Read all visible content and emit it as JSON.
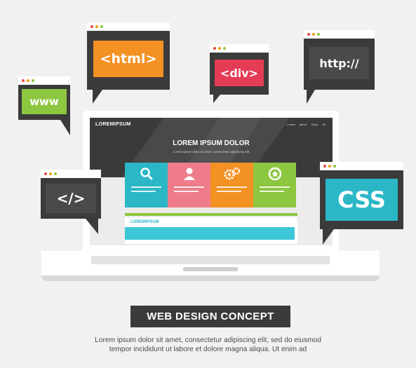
{
  "colors": {
    "background": "#f1f1f1",
    "dark": "#3b3b3b",
    "orange": "#f39123",
    "red": "#e53c55",
    "green": "#8dc63f",
    "cyan": "#2bb7c6",
    "pink": "#ee7c8a",
    "dot_red": "#e74c3c",
    "dot_yellow": "#f39c12",
    "dot_green": "#8dc63f"
  },
  "bubbles": {
    "html": {
      "label": "<html>",
      "panel_color": "#f39123"
    },
    "div": {
      "label": "<div>",
      "panel_color": "#e53c55"
    },
    "http": {
      "label": "http://",
      "panel_color": "#3b3b3b"
    },
    "www": {
      "label": "www",
      "panel_color": "#8dc63f"
    },
    "code": {
      "label": "</>",
      "panel_color": "#3b3b3b"
    },
    "css": {
      "label": "CSS",
      "panel_color": "#2bb7c6"
    }
  },
  "website": {
    "brand": "LOREMIPSUM",
    "nav": [
      "Lorem",
      "Ipsum",
      "Dolor",
      "Sit"
    ],
    "hero_title": "LOREM IPSUM DOLOR",
    "hero_subtitle": "Lorem ipsum dolor sit amet, consectetur adipiscing elit",
    "cards": [
      {
        "icon": "search-icon",
        "color": "#2bb7c6"
      },
      {
        "icon": "user-icon",
        "color": "#ee7c8a"
      },
      {
        "icon": "gears-icon",
        "color": "#f39123"
      },
      {
        "icon": "star-badge-icon",
        "color": "#8dc63f"
      }
    ],
    "section_label": "LOREMIPSUM"
  },
  "banner": {
    "title": "WEB DESIGN CONCEPT"
  },
  "description": {
    "line1": "Lorem ipsum dolor sit amet, consectetur adipiscing elit, sed do eiusmod",
    "line2": "tempor incididunt ut labore et dolore magna aliqua. Ut enim ad"
  }
}
